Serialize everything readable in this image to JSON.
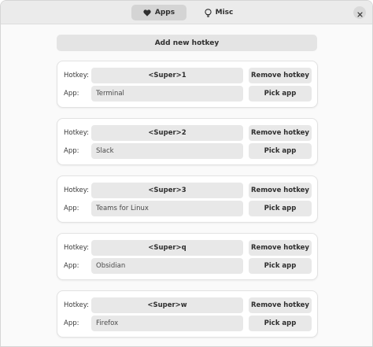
{
  "header": {
    "tabs": [
      {
        "label": "Apps",
        "icon": "heart-icon",
        "active": true
      },
      {
        "label": "Misc",
        "icon": "lightbulb-icon",
        "active": false
      }
    ],
    "close_icon": "close-icon"
  },
  "main": {
    "add_label": "Add new hotkey",
    "hotkey_label": "Hotkey:",
    "app_label": "App:",
    "remove_label": "Remove hotkey",
    "pick_label": "Pick app",
    "entries": [
      {
        "hotkey": "<Super>1",
        "app": "Terminal"
      },
      {
        "hotkey": "<Super>2",
        "app": "Slack"
      },
      {
        "hotkey": "<Super>3",
        "app": "Teams for Linux"
      },
      {
        "hotkey": "<Super>q",
        "app": "Obsidian"
      },
      {
        "hotkey": "<Super>w",
        "app": "Firefox"
      }
    ]
  },
  "colors": {
    "headerbar": "#ebebeb",
    "active_tab": "#d4d4d4",
    "button": "#e8e8e8",
    "card": "#ffffff",
    "background": "#fafafa"
  }
}
